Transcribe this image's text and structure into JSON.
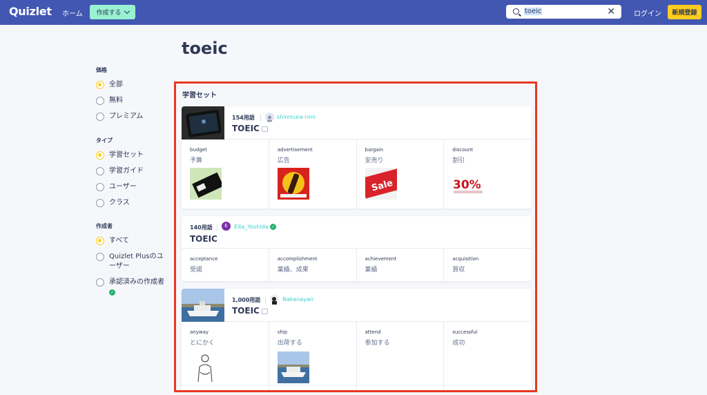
{
  "header": {
    "logo": "Quizlet",
    "home": "ホーム",
    "create": "作成する",
    "search_value": "toeic",
    "login": "ログイン",
    "signup": "新規登録"
  },
  "page_title": "toeic",
  "filters": {
    "price": {
      "title": "価格",
      "options": [
        "全部",
        "無料",
        "プレミアム"
      ],
      "selected": "全部"
    },
    "type": {
      "title": "タイプ",
      "options": [
        "学習セット",
        "学習ガイド",
        "ユーザー",
        "クラス"
      ],
      "selected": "学習セット"
    },
    "creator": {
      "title": "作成者",
      "options": [
        "すべて",
        "Quizlet Plusのユーザー",
        "承認済みの作成者"
      ],
      "selected": "すべて"
    }
  },
  "results": {
    "section_title": "学習セット",
    "sets": [
      {
        "count": "154用語",
        "user": "shinmura-rimi",
        "title": "TOEIC",
        "terms": [
          {
            "word": "budget",
            "def": "予算"
          },
          {
            "word": "advertisement",
            "def": "広告"
          },
          {
            "word": "bargain",
            "def": "安売り"
          },
          {
            "word": "discount",
            "def": "割引"
          }
        ]
      },
      {
        "count": "140用語",
        "user": "Eita_Yoshida",
        "avatar_letter": "E",
        "title": "TOEIC",
        "terms": [
          {
            "word": "acceptance",
            "def": "受諾"
          },
          {
            "word": "accomplishment",
            "def": "業績、成果"
          },
          {
            "word": "achievement",
            "def": "業績"
          },
          {
            "word": "acquisition",
            "def": "買収"
          }
        ]
      },
      {
        "count": "1,000用語",
        "user": "Nakanayan",
        "title": "TOEIC",
        "terms": [
          {
            "word": "anyway",
            "def": "とにかく"
          },
          {
            "word": "ship",
            "def": "出荷する"
          },
          {
            "word": "attend",
            "def": "参加する"
          },
          {
            "word": "successful",
            "def": "成功"
          }
        ]
      }
    ]
  },
  "image_text": {
    "sale": "Sale",
    "discount_badge": "30%"
  },
  "colors": {
    "header_bg": "#4257b2",
    "create_button": "#98f1d1",
    "signup_button": "#ffcd1f",
    "username": "#3ccfcf",
    "highlight_border": "#e8381f"
  }
}
